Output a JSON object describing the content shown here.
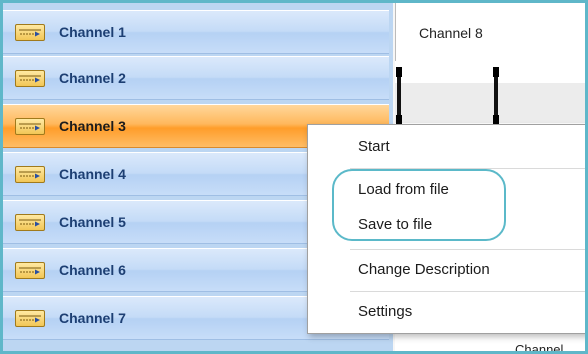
{
  "channels": [
    {
      "label": "Channel 1",
      "selected": false
    },
    {
      "label": "Channel 2",
      "selected": false
    },
    {
      "label": "Channel 3",
      "selected": true
    },
    {
      "label": "Channel 4",
      "selected": false
    },
    {
      "label": "Channel 5",
      "selected": false
    },
    {
      "label": "Channel 6",
      "selected": false
    },
    {
      "label": "Channel 7",
      "selected": false
    }
  ],
  "right_panel": {
    "header_label": "Channel 8",
    "bottom_label": "Channel"
  },
  "context_menu": {
    "items": [
      {
        "label": "Start"
      },
      {
        "label": "Load from file"
      },
      {
        "label": "Save to file"
      },
      {
        "label": "Change Description"
      },
      {
        "label": "Settings"
      }
    ]
  },
  "colors": {
    "frame_border": "#5fb7c9",
    "channel_bg": "#c4dbf7",
    "selected_bg": "#ff9d2a",
    "highlight_ring": "#5bb9c9"
  },
  "icons": {
    "channel_icon": "keyboard-channel-icon"
  }
}
